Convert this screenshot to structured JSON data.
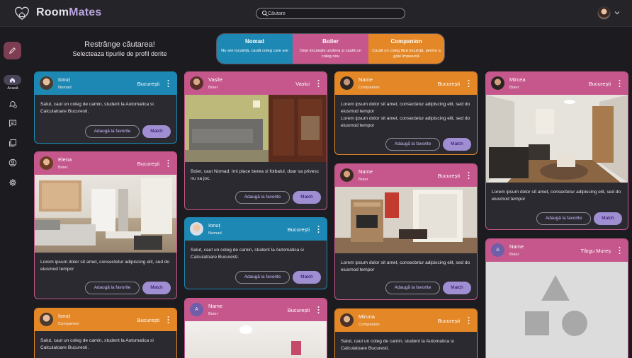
{
  "app": {
    "logo_main": "Room",
    "logo_accent": "Mates"
  },
  "search": {
    "placeholder": "Căutare"
  },
  "sidebar": {
    "home_label": "Acasă"
  },
  "filter": {
    "title": "Restrânge căutarea!",
    "subtitle": "Selecteaza tipurile de profil dorite",
    "options": [
      {
        "title": "Nomad",
        "desc": "Nu are locuință, caută coleg care are",
        "color": "#1d88b4"
      },
      {
        "title": "Boiler",
        "desc": "Deja locuiește undeva și caută un coleg nou",
        "color": "#c5578c"
      },
      {
        "title": "Companion",
        "desc": "Caută un coleg fără locuință, pentru a găsi împreună",
        "color": "#e48726"
      }
    ]
  },
  "buttons": {
    "favorite": "Adaugă la favorite",
    "match": "Match"
  },
  "cards": {
    "c1": {
      "name": "Ionuț",
      "type": "Nomad",
      "city": "București",
      "desc": "Salut, caut un coleg de camin, student la Automatica si Calculatoare Bucuresti."
    },
    "c2": {
      "name": "Elena",
      "type": "Boier",
      "city": "București",
      "desc": "Lorem ipsum dolor sit amet, consectetur adipiscing elit, sed do eiusmod tempor"
    },
    "c3": {
      "name": "Ionuț",
      "type": "Companion",
      "city": "București",
      "desc": "Salut, caut un coleg de camin, student la Automatica si Calculatoare Bucuresti."
    },
    "c4": {
      "name": "Vasile",
      "type": "Boier",
      "city": "Vaslui",
      "desc": "Boier, caut Nomad. Imi place berea si fotbalul, doar sa privesc nu sa joc."
    },
    "c5": {
      "name": "Ionuț",
      "type": "Nomad",
      "city": "București",
      "desc": "Salut, caut un coleg de camin, student la Automatica si Calculatoare Bucuresti."
    },
    "c6": {
      "name": "Name",
      "type": "Boier",
      "city": "București",
      "avatar_letter": "A",
      "desc": ""
    },
    "c7": {
      "name": "Name",
      "type": "Companion",
      "city": "București",
      "desc": "Lorem ipsum dolor sit amet, consectetur adipiscing elit, sed do eiusmod tempor\nLorem ipsum dolor sit amet, consectetur adipiscing elit, sed do eiusmod tempor"
    },
    "c8": {
      "name": "Name",
      "type": "Boier",
      "city": "București",
      "desc": "Lorem ipsum dolor sit amet, consectetur adipiscing elit, sed do eiusmod tempor"
    },
    "c9": {
      "name": "Miruna",
      "type": "Companion",
      "city": "București",
      "desc": "Salut, caut un coleg de camin, student la Automatica si Calculatoare Bucuresti."
    },
    "c10": {
      "name": "Mircea",
      "type": "Boier",
      "city": "București",
      "desc": "Lorem ipsum dolor sit amet, consectetur adipiscing elit, sed do eiusmod tempor"
    },
    "c11": {
      "name": "Name",
      "type": "Boier",
      "city": "Târgu Mureș",
      "avatar_letter": "A",
      "desc": ""
    }
  }
}
